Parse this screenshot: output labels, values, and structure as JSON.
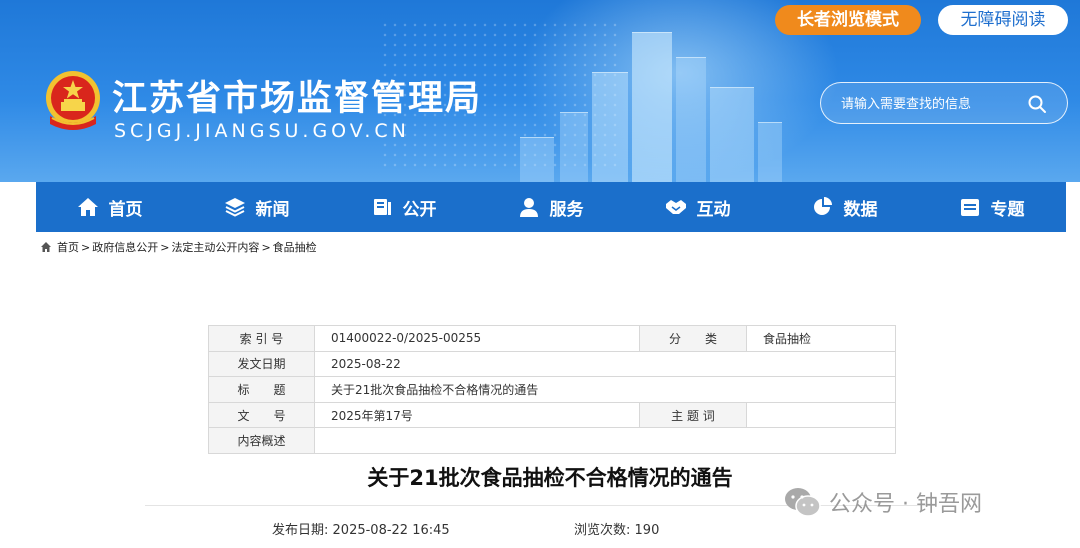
{
  "header": {
    "elder_mode_label": "长者浏览模式",
    "accessibility_label": "无障碍阅读",
    "site_title": "江苏省市场监督管理局",
    "site_domain": "SCJGJ.JIANGSU.GOV.CN",
    "search_placeholder": "请输入需要查找的信息"
  },
  "nav": {
    "items": [
      {
        "label": "首页",
        "icon": "home-icon"
      },
      {
        "label": "新闻",
        "icon": "layers-icon"
      },
      {
        "label": "公开",
        "icon": "documents-icon"
      },
      {
        "label": "服务",
        "icon": "user-icon"
      },
      {
        "label": "互动",
        "icon": "handshake-icon"
      },
      {
        "label": "数据",
        "icon": "pie-chart-icon"
      },
      {
        "label": "专题",
        "icon": "calendar-icon"
      }
    ]
  },
  "breadcrumb": [
    "首页",
    "政府信息公开",
    "法定主动公开内容",
    "食品抽检"
  ],
  "meta": {
    "index_label": "索 引 号",
    "index_value": "01400022-0/2025-00255",
    "category_label": "分　　类",
    "category_value": "食品抽检",
    "date_label": "发文日期",
    "date_value": "2025-08-22",
    "title_label": "标　　题",
    "title_value": "关于21批次食品抽检不合格情况的通告",
    "doc_no_label": "文　　号",
    "doc_no_value": "2025年第17号",
    "keywords_label": "主 题 词",
    "keywords_value": "",
    "summary_label": "内容概述",
    "summary_value": ""
  },
  "article": {
    "title": "关于21批次食品抽检不合格情况的通告",
    "publish_label": "发布日期:",
    "publish_value": "2025-08-22 16:45",
    "views_label": "浏览次数:",
    "views_value": "190"
  },
  "watermark": {
    "text": "公众号 · 钟吾网"
  },
  "colors": {
    "banner_blue": "#2f8ae6",
    "nav_blue": "#1b6fcb",
    "elder_orange": "#f08a1c"
  }
}
